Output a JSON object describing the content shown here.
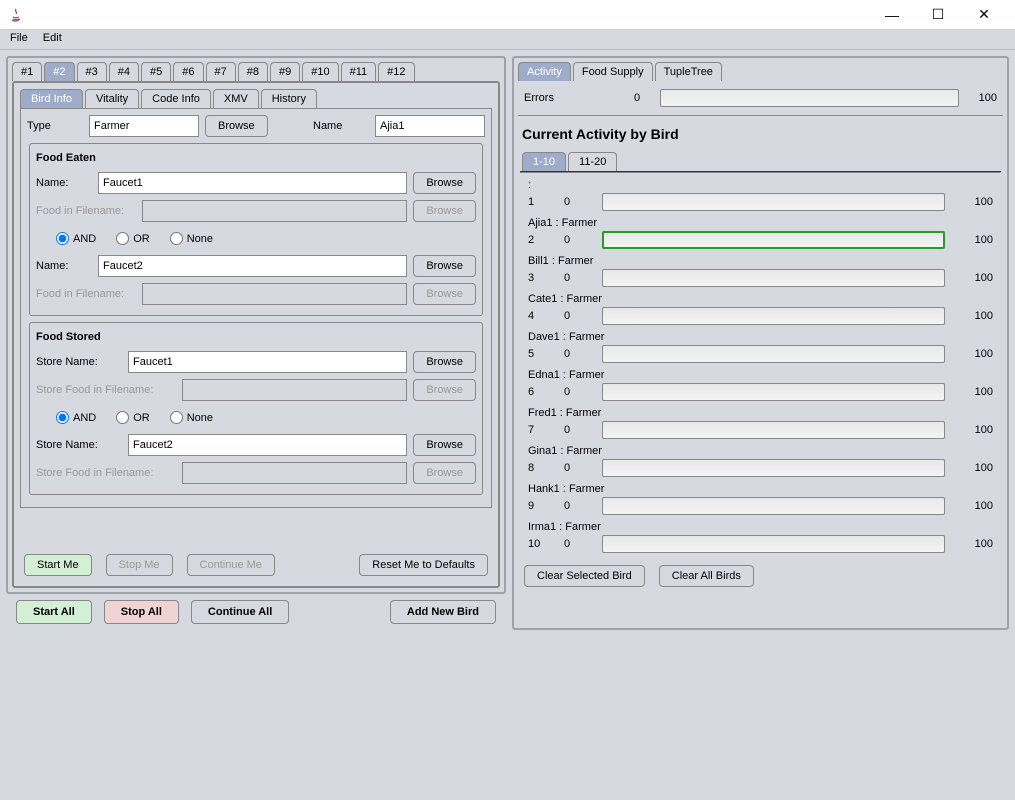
{
  "menu": {
    "file": "File",
    "edit": "Edit"
  },
  "window": {
    "min": "—",
    "max": "☐",
    "close": "✕"
  },
  "topTabs": [
    "#1",
    "#2",
    "#3",
    "#4",
    "#5",
    "#6",
    "#7",
    "#8",
    "#9",
    "#10",
    "#11",
    "#12"
  ],
  "topTabActive": 1,
  "subTabs": [
    "Bird Info",
    "Vitality",
    "Code Info",
    "XMV",
    "History"
  ],
  "subTabActive": 0,
  "form": {
    "typeLabel": "Type",
    "typeValue": "Farmer",
    "browse": "Browse",
    "nameLabel": "Name",
    "nameValue": "Ajia1"
  },
  "foodEaten": {
    "title": "Food Eaten",
    "nameLabel": "Name:",
    "name1": "Faucet1",
    "ffLabel": "Food in Filename:",
    "and": "AND",
    "or": "OR",
    "none": "None",
    "name2": "Faucet2"
  },
  "foodStored": {
    "title": "Food Stored",
    "snLabel": "Store Name:",
    "sn1": "Faucet1",
    "sffLabel": "Store Food in Filename:",
    "and": "AND",
    "or": "OR",
    "none": "None",
    "sn2": "Faucet2"
  },
  "leftBtns": {
    "start": "Start Me",
    "stop": "Stop Me",
    "cont": "Continue Me",
    "reset": "Reset Me to Defaults"
  },
  "bottom": {
    "startAll": "Start All",
    "stopAll": "Stop All",
    "contAll": "Continue All",
    "addNew": "Add New Bird"
  },
  "rightTabs": [
    "Activity",
    "Food Supply",
    "TupleTree"
  ],
  "rightTabActive": 0,
  "errors": {
    "label": "Errors",
    "val": "0",
    "max": "100"
  },
  "activityTitle": "Current Activity by Bird",
  "pageTabs": [
    "1-10",
    "11-20"
  ],
  "pageTabActive": 0,
  "birds": [
    {
      "name": ":",
      "idx": "1",
      "val": "0",
      "max": "100",
      "hl": false
    },
    {
      "name": "Ajia1 : Farmer",
      "idx": "2",
      "val": "0",
      "max": "100",
      "hl": true
    },
    {
      "name": "Bill1 : Farmer",
      "idx": "3",
      "val": "0",
      "max": "100",
      "hl": false
    },
    {
      "name": "Cate1 : Farmer",
      "idx": "4",
      "val": "0",
      "max": "100",
      "hl": false
    },
    {
      "name": "Dave1 : Farmer",
      "idx": "5",
      "val": "0",
      "max": "100",
      "hl": false
    },
    {
      "name": "Edna1 : Farmer",
      "idx": "6",
      "val": "0",
      "max": "100",
      "hl": false
    },
    {
      "name": "Fred1 : Farmer",
      "idx": "7",
      "val": "0",
      "max": "100",
      "hl": false
    },
    {
      "name": "Gina1 : Farmer",
      "idx": "8",
      "val": "0",
      "max": "100",
      "hl": false
    },
    {
      "name": "Hank1 : Farmer",
      "idx": "9",
      "val": "0",
      "max": "100",
      "hl": false
    },
    {
      "name": "Irma1 : Farmer",
      "idx": "10",
      "val": "0",
      "max": "100",
      "hl": false
    }
  ],
  "rightBtns": {
    "clearSel": "Clear Selected Bird",
    "clearAll": "Clear All Birds"
  }
}
